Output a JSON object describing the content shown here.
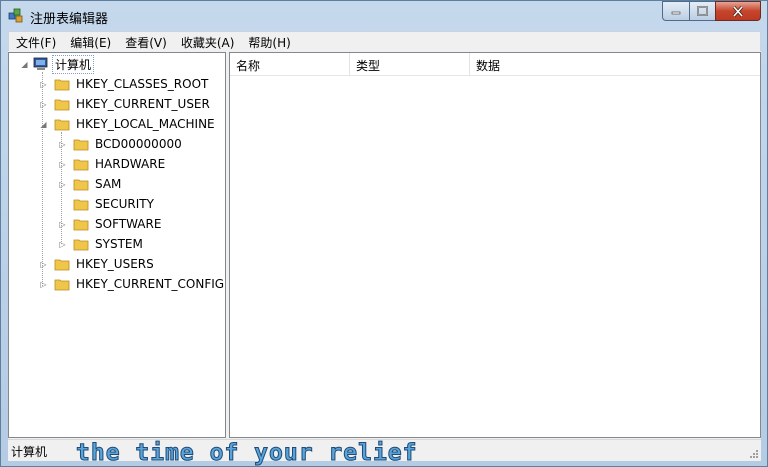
{
  "window": {
    "title": "注册表编辑器"
  },
  "menu": [
    {
      "label": "文件(F)"
    },
    {
      "label": "编辑(E)"
    },
    {
      "label": "查看(V)"
    },
    {
      "label": "收藏夹(A)"
    },
    {
      "label": "帮助(H)"
    }
  ],
  "tree": {
    "root": "计算机",
    "hives": [
      {
        "label": "HKEY_CLASSES_ROOT",
        "expander": "▷"
      },
      {
        "label": "HKEY_CURRENT_USER",
        "expander": "▷"
      },
      {
        "label": "HKEY_LOCAL_MACHINE",
        "expander": "◢"
      },
      {
        "label": "HKEY_USERS",
        "expander": "▷"
      },
      {
        "label": "HKEY_CURRENT_CONFIG",
        "expander": "▷"
      }
    ],
    "children": [
      {
        "label": "BCD00000000",
        "expander": "▷"
      },
      {
        "label": "HARDWARE",
        "expander": "▷"
      },
      {
        "label": "SAM",
        "expander": "▷"
      },
      {
        "label": "SECURITY",
        "expander": ""
      },
      {
        "label": "SOFTWARE",
        "expander": "▷"
      },
      {
        "label": "SYSTEM",
        "expander": "▷"
      }
    ]
  },
  "columns": [
    {
      "label": "名称"
    },
    {
      "label": "类型"
    },
    {
      "label": "数据"
    }
  ],
  "status": {
    "text": "计算机"
  },
  "overlay": {
    "caption": "the time of your relief"
  },
  "colors": {
    "folder": "#f0c64a",
    "close": "#c5452c",
    "selection_outline": "#7da2ce"
  }
}
